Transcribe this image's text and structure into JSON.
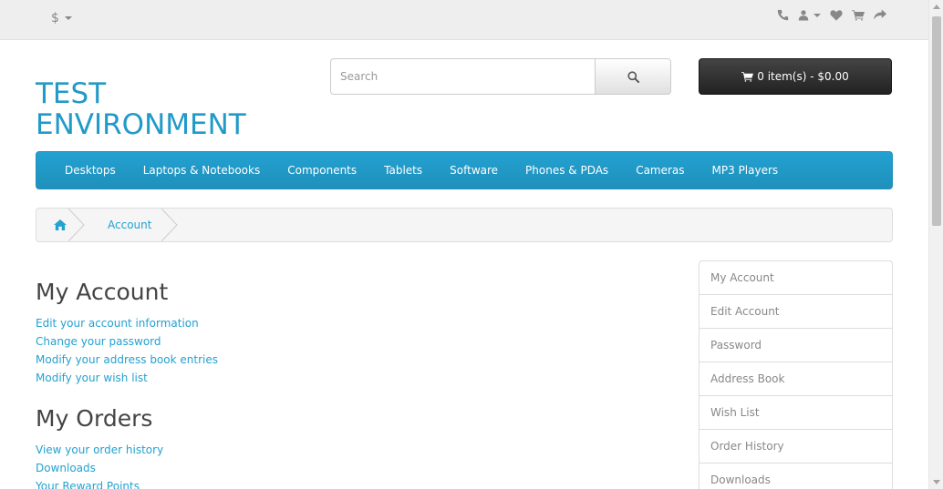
{
  "top_bar": {
    "currency_symbol": "$",
    "icons": [
      "phone-icon",
      "user-icon",
      "heart-icon",
      "cart-icon",
      "share-icon"
    ]
  },
  "header": {
    "logo_line1": "TEST",
    "logo_line2": "ENVIRONMENT",
    "search_placeholder": "Search",
    "cart_label": "0 item(s) - $0.00"
  },
  "menu": {
    "items": [
      "Desktops",
      "Laptops & Notebooks",
      "Components",
      "Tablets",
      "Software",
      "Phones & PDAs",
      "Cameras",
      "MP3 Players"
    ]
  },
  "breadcrumb": {
    "account_label": "Account"
  },
  "content": {
    "my_account_title": "My Account",
    "account_links": [
      "Edit your account information",
      "Change your password",
      "Modify your address book entries",
      "Modify your wish list"
    ],
    "my_orders_title": "My Orders",
    "order_links": [
      "View your order history",
      "Downloads",
      "Your Reward Points"
    ]
  },
  "sidebar": {
    "items": [
      "My Account",
      "Edit Account",
      "Password",
      "Address Book",
      "Wish List",
      "Order History",
      "Downloads"
    ]
  },
  "colors": {
    "accent": "#229ac8",
    "link": "#23a1d1",
    "cart_bg": "#333333"
  }
}
